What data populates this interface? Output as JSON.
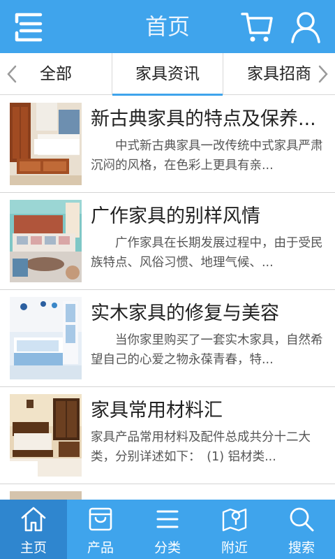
{
  "header": {
    "title": "首页",
    "icons": [
      "menu-icon",
      "cart-icon",
      "user-icon"
    ]
  },
  "tabs": [
    {
      "label": "全部"
    },
    {
      "label": "家具资讯",
      "selected": true
    },
    {
      "label": "家具招商"
    }
  ],
  "articles": [
    {
      "title": "新古典家具的特点及保养...",
      "summary": "中式新古典家具一改传统中式家具严肃沉闷的风格，在色彩上更具有亲...",
      "thumbnail": "bedroom-wood-furniture-photo"
    },
    {
      "title": "广作家具的别样风情",
      "summary": "广作家具在长期发展过程中，由于受民族特点、风俗习惯、地理气候、...",
      "thumbnail": "living-room-sofa-photo"
    },
    {
      "title": "实木家具的修复与美容",
      "summary": "当你家里购买了一套实木家具，自然希望自己的心爱之物永葆青春，特...",
      "thumbnail": "blue-kids-bedroom-photo"
    },
    {
      "title": "家具常用材料汇",
      "summary": "家具产品常用材料及配件总成共分十二大类，分别详述如下：　(1) 铝材类...",
      "thumbnail": "classic-bedroom-photo"
    },
    {
      "title": "",
      "summary": "",
      "thumbnail": "partial-item-photo"
    }
  ],
  "bottom_nav": [
    {
      "label": "主页",
      "icon": "home-icon",
      "active": true
    },
    {
      "label": "产品",
      "icon": "bag-icon"
    },
    {
      "label": "分类",
      "icon": "list-icon"
    },
    {
      "label": "附近",
      "icon": "map-icon"
    },
    {
      "label": "搜索",
      "icon": "search-icon"
    }
  ],
  "colors": {
    "primary": "#3fa4ec",
    "active_nav": "#2f86cf",
    "tab_underline": "#3fa4ec"
  }
}
